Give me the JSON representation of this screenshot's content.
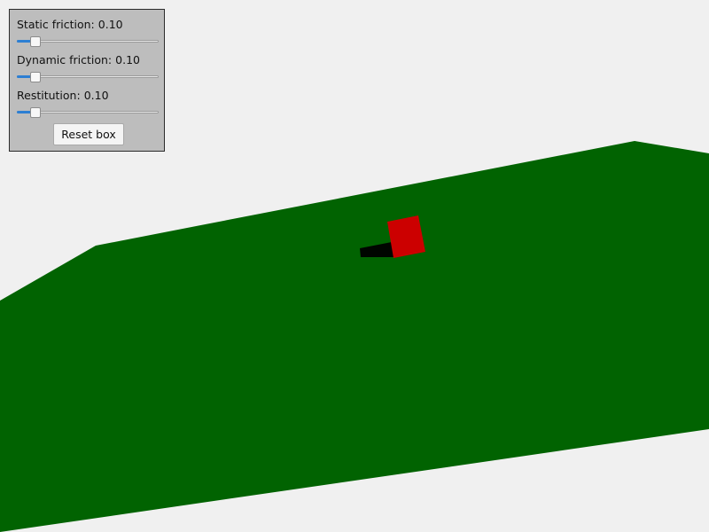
{
  "controls": {
    "static_friction": {
      "label": "Static friction:",
      "value_text": "0.10",
      "fraction": 0.1
    },
    "dynamic_friction": {
      "label": "Dynamic friction:",
      "value_text": "0.10",
      "fraction": 0.1
    },
    "restitution": {
      "label": "Restitution:",
      "value_text": "0.10",
      "fraction": 0.1
    },
    "reset_label": "Reset box"
  },
  "colors": {
    "background": "#f0f0f0",
    "ground": "#016301",
    "box": "#cc0000",
    "shadow": "#000000",
    "panel": "#bdbdbd",
    "slider_fill": "#2d7fd3"
  }
}
